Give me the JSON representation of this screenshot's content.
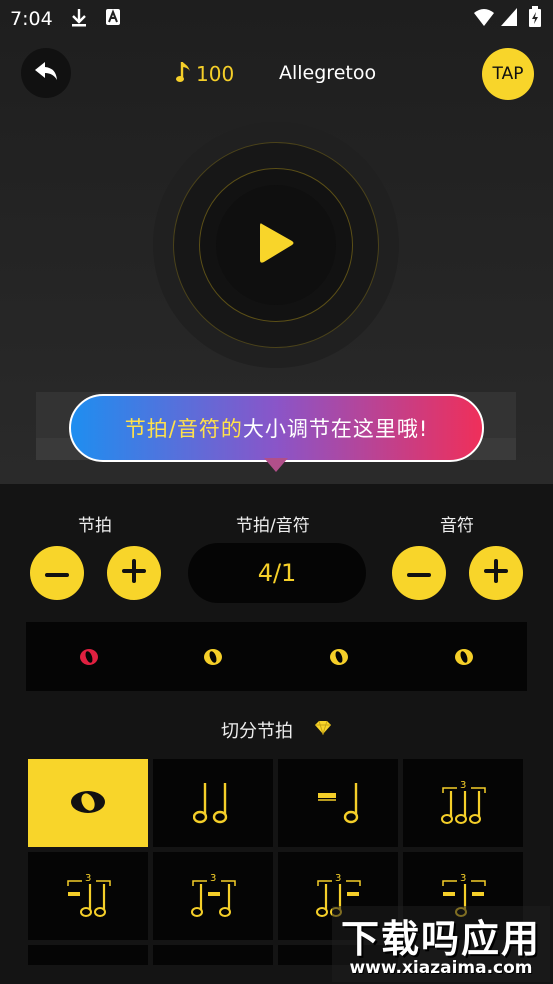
{
  "status_bar": {
    "time": "7:04"
  },
  "header": {
    "tempo": "100",
    "tempo_name": "Allegretoo",
    "tap_label": "TAP"
  },
  "tooltip": {
    "highlight": "节拍/音符的",
    "rest": "大小调节在这里哦!"
  },
  "controls": {
    "beat_label": "节拍",
    "ratio_label": "节拍/音符",
    "note_label": "音符",
    "ratio_value": "4/1"
  },
  "beats": {
    "count": 4,
    "accent_color": "#e02040",
    "normal_color": "#f5cf29"
  },
  "syncopation": {
    "title": "切分节拍"
  },
  "colors": {
    "accent": "#f8d52a",
    "background": "#141414"
  },
  "watermark": {
    "title": "下载吗应用",
    "url": "www.xiazaima.com"
  }
}
